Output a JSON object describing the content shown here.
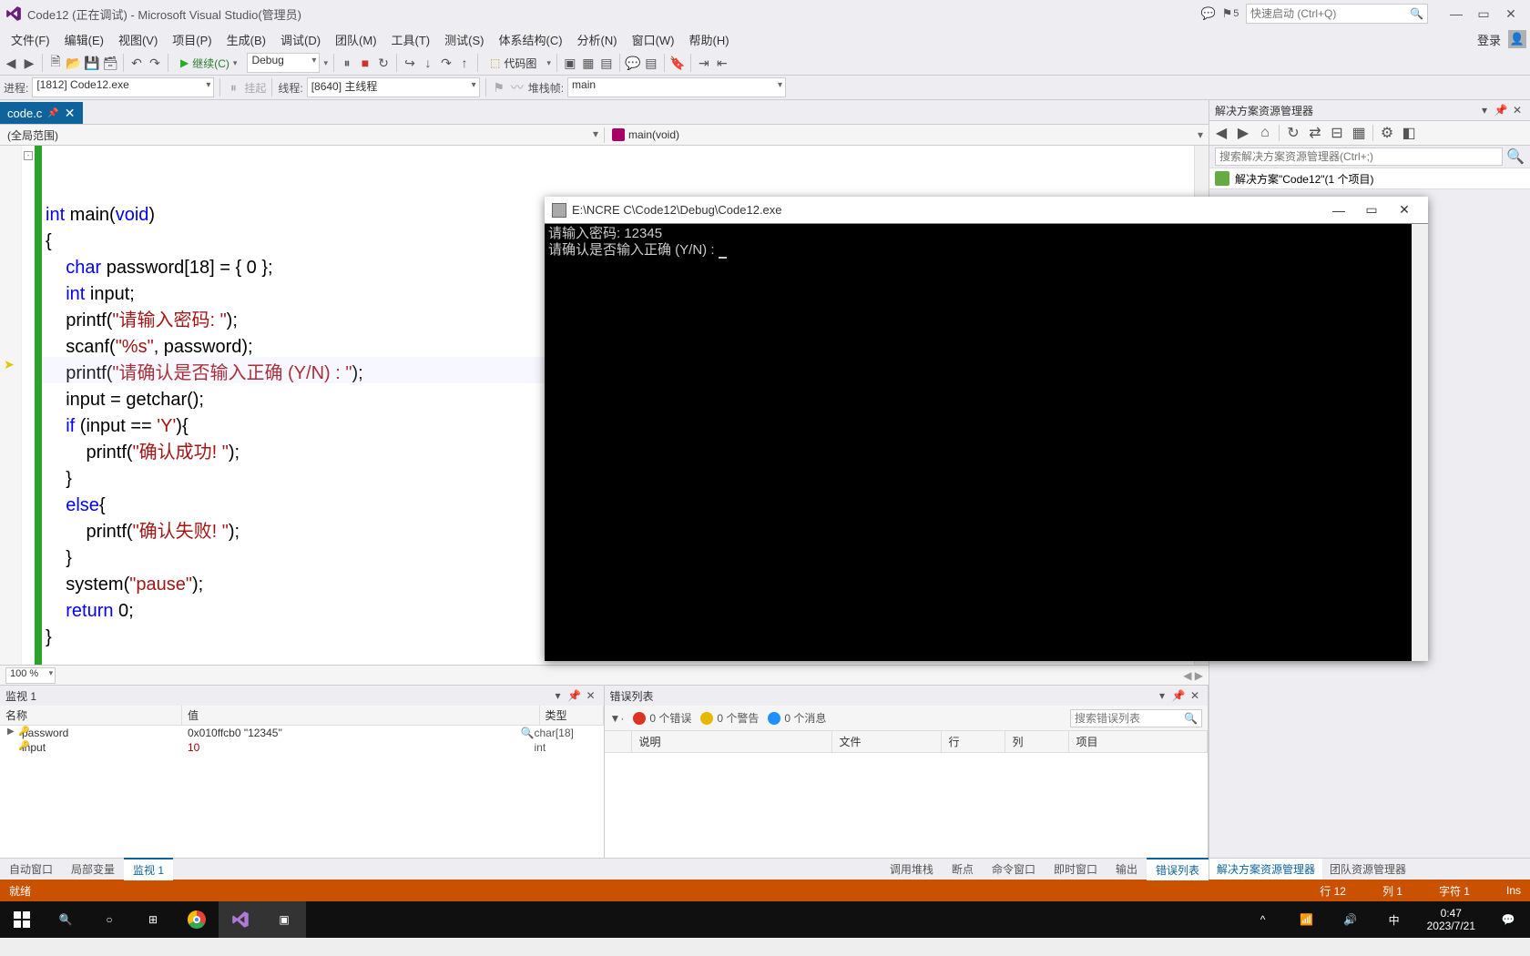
{
  "window": {
    "title": "Code12 (正在调试) - Microsoft Visual Studio(管理员)",
    "notif_count": "5",
    "search_placeholder": "快速启动 (Ctrl+Q)"
  },
  "menu": {
    "file": "文件(F)",
    "edit": "编辑(E)",
    "view": "视图(V)",
    "project": "项目(P)",
    "build": "生成(B)",
    "debug": "调试(D)",
    "team": "团队(M)",
    "tools": "工具(T)",
    "test": "测试(S)",
    "arch": "体系结构(C)",
    "analyze": "分析(N)",
    "win": "窗口(W)",
    "help": "帮助(H)",
    "login": "登录"
  },
  "toolbar1": {
    "continue": "继续(C)",
    "config": "Debug",
    "codemap": "代码图"
  },
  "toolbar2": {
    "proc_lbl": "进程:",
    "proc_val": "[1812] Code12.exe",
    "suspend": "挂起",
    "thread_lbl": "线程:",
    "thread_val": "[8640] 主线程",
    "frame_lbl": "堆栈帧:",
    "frame_val": "main"
  },
  "tab": {
    "name": "code.c"
  },
  "nav": {
    "left": "(全局范围)",
    "right": "main(void)"
  },
  "code": {
    "l1a": "int",
    "l1b": " main(",
    "l1c": "void",
    "l1d": ")",
    "l2": "{",
    "l3a": "    ",
    "l3b": "char",
    "l3c": " password[18] = { 0 };",
    "l4a": "    ",
    "l4b": "int",
    "l4c": " input;",
    "l5a": "    printf(",
    "l5b": "\"请输入密码: \"",
    "l5c": ");",
    "l6a": "    scanf(",
    "l6b": "\"%s\"",
    "l6c": ", password);",
    "l7a": "    printf(",
    "l7b": "\"请确认是否输入正确 (Y/N) : \"",
    "l7c": ");",
    "l8": "    input = getchar();",
    "l9a": "    ",
    "l9b": "if",
    "l9c": " (input == ",
    "l9d": "'Y'",
    "l9e": "){",
    "l10a": "        printf(",
    "l10b": "\"确认成功! \"",
    "l10c": ");",
    "l11": "    }",
    "l12a": "    ",
    "l12b": "else",
    "l12c": "{",
    "l13a": "        printf(",
    "l13b": "\"确认失败! \"",
    "l13c": ");",
    "l14": "    }",
    "l15a": "    system(",
    "l15b": "\"pause\"",
    "l15c": ");",
    "l16a": "    ",
    "l16b": "return",
    "l16c": " 0;",
    "l17": "}"
  },
  "zoom": "100 %",
  "watch": {
    "title": "监视 1",
    "cols": {
      "name": "名称",
      "value": "值",
      "type": "类型"
    },
    "rows": [
      {
        "name": "password",
        "value": "0x010ffcb0 \"12345\"",
        "type": "char[18]"
      },
      {
        "name": "input",
        "value": "10",
        "type": "int"
      }
    ]
  },
  "left_tabs": {
    "auto": "自动窗口",
    "locals": "局部变量",
    "watch": "监视 1"
  },
  "errlist": {
    "title": "错误列表",
    "errors": "0 个错误",
    "warnings": "0 个警告",
    "info": "0 个消息",
    "search_ph": "搜索错误列表",
    "cols": {
      "desc": "说明",
      "file": "文件",
      "line": "行",
      "col": "列",
      "proj": "项目"
    }
  },
  "right_tabs": {
    "call": "调用堆栈",
    "break": "断点",
    "cmd": "命令窗口",
    "imm": "即时窗口",
    "out": "输出",
    "err": "错误列表"
  },
  "solution": {
    "title": "解决方案资源管理器",
    "search_ph": "搜索解决方案资源管理器(Ctrl+;)",
    "root": "解决方案\"Code12\"(1 个项目)"
  },
  "sol_tabs": {
    "sol": "解决方案资源管理器",
    "team": "团队资源管理器"
  },
  "status": {
    "ready": "就绪",
    "line": "行 12",
    "col": "列 1",
    "char": "字符 1",
    "ins": "Ins"
  },
  "console": {
    "title": "E:\\NCRE C\\Code12\\Debug\\Code12.exe",
    "l1": "请输入密码: 12345",
    "l2": "请确认是否输入正确 (Y/N) : "
  },
  "clock": {
    "time": "0:47",
    "date": "2023/7/21",
    "ime": "中"
  }
}
